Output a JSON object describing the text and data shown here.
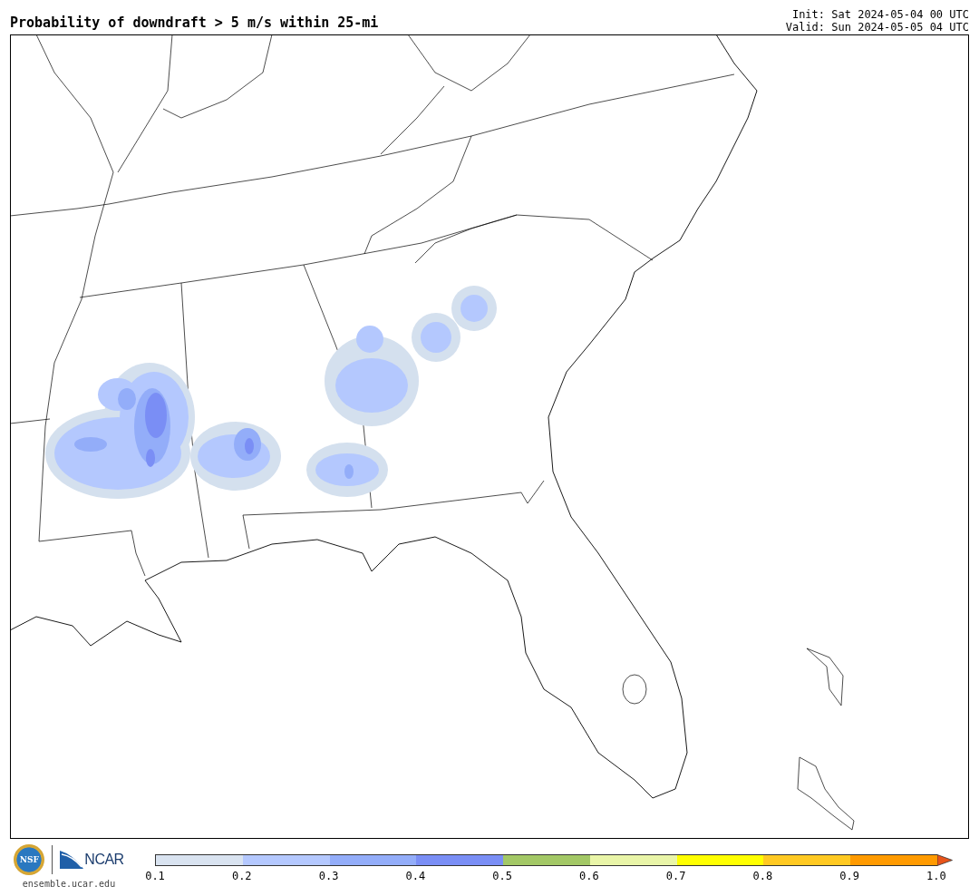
{
  "header": {
    "title": "Probability of downdraft > 5 m/s within 25-mi",
    "init": "Init: Sat 2024-05-04 00 UTC",
    "valid": "Valid: Sun 2024-05-05 04 UTC"
  },
  "logos": {
    "nsf": "NSF",
    "ncar": "NCAR",
    "site": "ensemble.ucar.edu"
  },
  "colorbar": {
    "segments": [
      {
        "color": "#d9e3f0"
      },
      {
        "color": "#b4c8fe"
      },
      {
        "color": "#93adf9"
      },
      {
        "color": "#7a8ef5"
      },
      {
        "color": "#a3c866"
      },
      {
        "color": "#e9f5a8"
      },
      {
        "color": "#ffff00"
      },
      {
        "color": "#ffc922"
      },
      {
        "color": "#ff9a00"
      }
    ],
    "extension": {
      "kind": "triangle",
      "color": "#e8541a"
    },
    "ticks": [
      "0.1",
      "0.2",
      "0.3",
      "0.4",
      "0.5",
      "0.6",
      "0.7",
      "0.8",
      "0.9",
      "1.0"
    ]
  }
}
